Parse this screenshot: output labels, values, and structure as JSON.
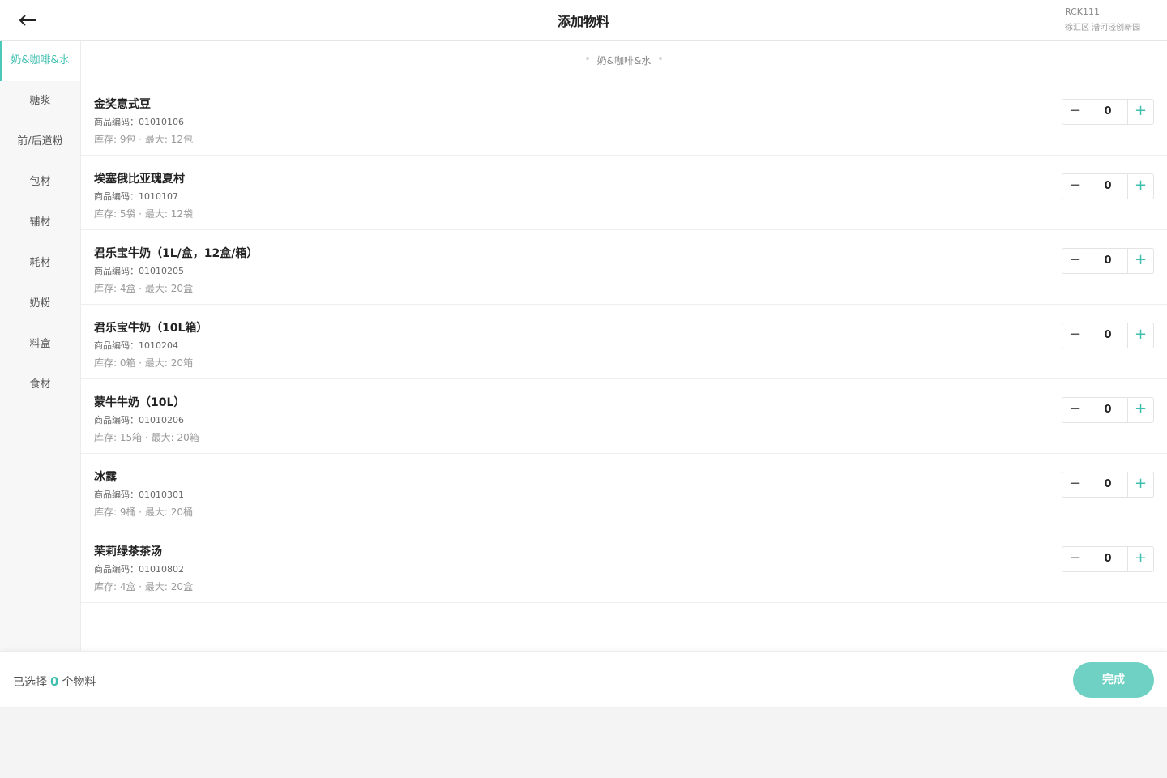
{
  "header": {
    "title": "添加物料",
    "store_code": "RCK111",
    "store_address": "徐汇区 漕河泾创新园"
  },
  "sidebar": {
    "items": [
      {
        "label": "奶&咖啡&水",
        "active": true
      },
      {
        "label": "糖浆"
      },
      {
        "label": "前/后道粉"
      },
      {
        "label": "包材"
      },
      {
        "label": "辅材"
      },
      {
        "label": "耗材"
      },
      {
        "label": "奶粉"
      },
      {
        "label": "料盒"
      },
      {
        "label": "食材"
      }
    ]
  },
  "section": {
    "title": "奶&咖啡&水"
  },
  "products": [
    {
      "name": "金奖意式豆",
      "code": "商品编码：01010106",
      "stock": "库存: 9包 · 最大: 12包",
      "qty": "0"
    },
    {
      "name": "埃塞俄比亚瑰夏村",
      "code": "商品编码：1010107",
      "stock": "库存: 5袋 · 最大: 12袋",
      "qty": "0"
    },
    {
      "name": "君乐宝牛奶（1L/盒，12盒/箱）",
      "code": "商品编码：01010205",
      "stock": "库存: 4盒 · 最大: 20盒",
      "qty": "0"
    },
    {
      "name": "君乐宝牛奶（10L箱）",
      "code": "商品编码：1010204",
      "stock": "库存: 0箱 · 最大: 20箱",
      "qty": "0"
    },
    {
      "name": "蒙牛牛奶（10L）",
      "code": "商品编码：01010206",
      "stock": "库存: 15箱 · 最大: 20箱",
      "qty": "0"
    },
    {
      "name": "冰露",
      "code": "商品编码：01010301",
      "stock": "库存: 9桶 · 最大: 20桶",
      "qty": "0"
    },
    {
      "name": "茉莉绿茶茶汤",
      "code": "商品编码：01010802",
      "stock": "库存: 4盒 · 最大: 20盒",
      "qty": "0"
    }
  ],
  "stepper": {
    "minus_symbol": "−",
    "plus_symbol": "+"
  },
  "footer": {
    "selected_prefix": "已选择",
    "selected_count": "0",
    "selected_suffix": "个物料",
    "done_label": "完成"
  },
  "colors": {
    "accent": "#4cc9b9",
    "button": "#6fd0c4"
  }
}
